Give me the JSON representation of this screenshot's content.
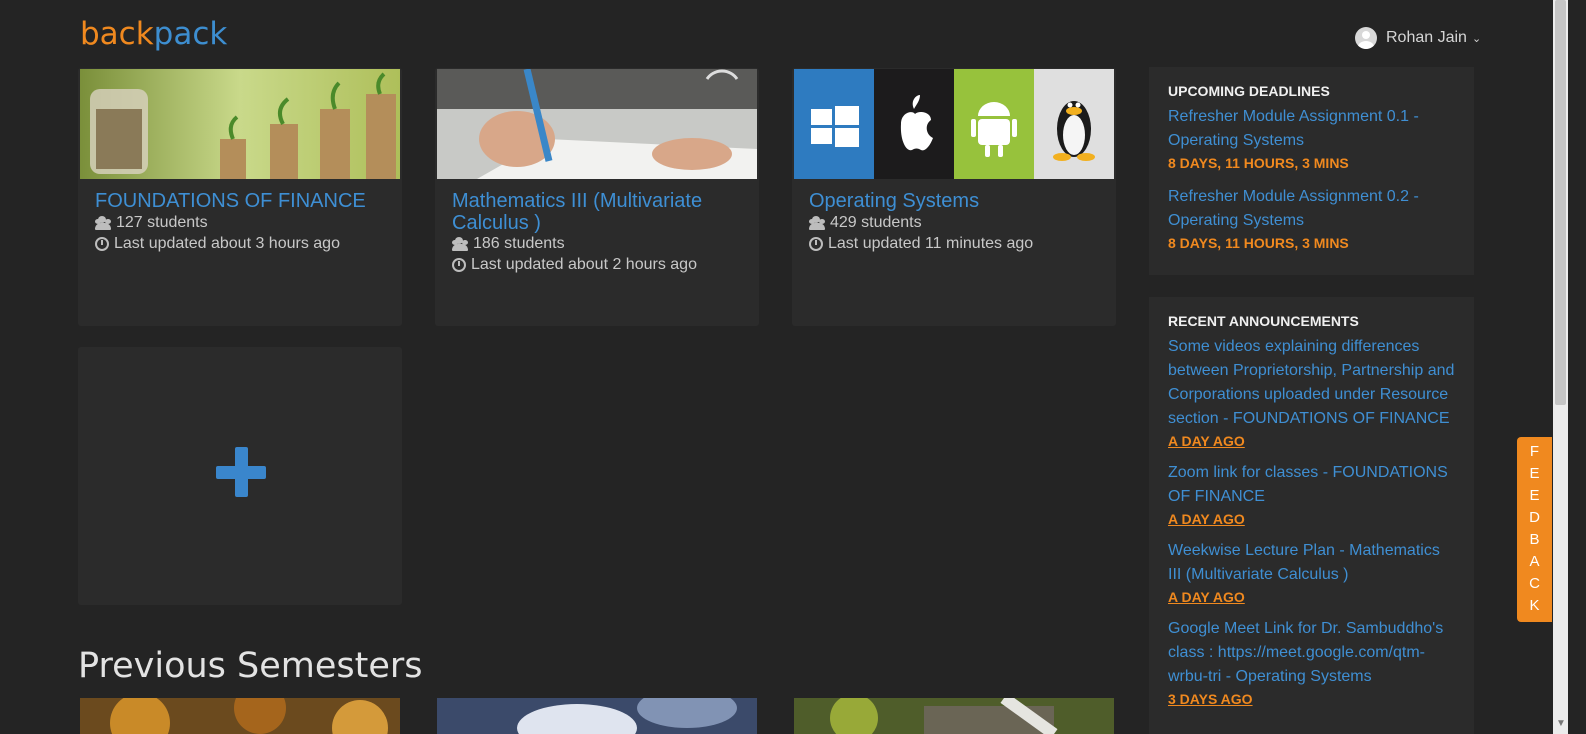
{
  "brand": {
    "logo_part1": "back",
    "logo_part2": "pack"
  },
  "user": {
    "name": "Rohan Jain"
  },
  "courses": [
    {
      "title": "FOUNDATIONS OF FINANCE",
      "students": "127 students",
      "updated": "Last updated about 3 hours ago"
    },
    {
      "title": "Mathematics III (Multivariate Calculus )",
      "students": "186 students",
      "updated": "Last updated about 2 hours ago"
    },
    {
      "title": "Operating Systems",
      "students": "429 students",
      "updated": "Last updated 11 minutes ago"
    }
  ],
  "previous_semesters": "Previous Semesters",
  "deadlines": {
    "heading": "UPCOMING DEADLINES",
    "items": [
      {
        "title": "Refresher Module Assignment 0.1 - Operating Systems",
        "due": "8 DAYS, 11 HOURS, 3 MINS"
      },
      {
        "title": "Refresher Module Assignment 0.2 - Operating Systems",
        "due": "8 DAYS, 11 HOURS, 3 MINS"
      }
    ]
  },
  "announcements": {
    "heading": "RECENT ANNOUNCEMENTS",
    "items": [
      {
        "title": "Some videos explaining differences between Proprietorship, Partnership and Corporations uploaded under Resource section - FOUNDATIONS OF FINANCE",
        "when": "A DAY AGO"
      },
      {
        "title": "Zoom link for classes - FOUNDATIONS OF FINANCE",
        "when": "A DAY AGO"
      },
      {
        "title": "Weekwise Lecture Plan - Mathematics III (Multivariate Calculus )",
        "when": "A DAY AGO"
      },
      {
        "title": "Google Meet Link for Dr. Sambuddho's class : https://meet.google.com/qtm-wrbu-tri - Operating Systems",
        "when": "3 DAYS AGO"
      }
    ]
  },
  "feedback": [
    "F",
    "E",
    "E",
    "D",
    "B",
    "A",
    "C",
    "K"
  ],
  "colors": {
    "accent": "#3e8fd4",
    "orange": "#f0891f",
    "bg": "#242424",
    "card": "#2b2b2b"
  }
}
